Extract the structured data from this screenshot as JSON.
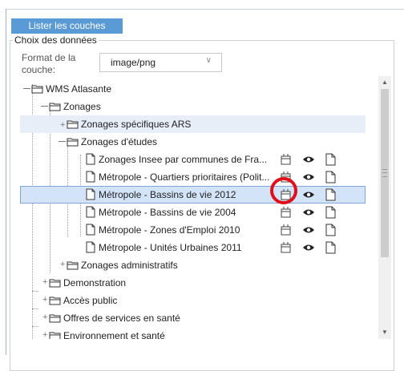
{
  "toolbar": {
    "list_layers_label": "Lister les couches"
  },
  "panel": {
    "legend": "Choix des données",
    "format_label": "Format de la couche:",
    "format_value": "image/png"
  },
  "tree": {
    "root": "WMS Atlasante",
    "zonages": "Zonages",
    "zonages_ars": "Zonages spécifiques ARS",
    "zonages_etudes": "Zonages d'études",
    "layers": [
      "Zonages Insee par communes de Fra...",
      "Métropole - Quartiers prioritaires (Polit...",
      "Métropole - Bassins de vie 2012",
      "Métropole - Bassins de vie 2004",
      "Métropole - Zones d'Emploi 2010",
      "Métropole - Unités Urbaines 2011"
    ],
    "zonages_admin": "Zonages administratifs",
    "others": [
      "Demonstration",
      "Accès public",
      "Offres de services en santé",
      "Environnement et santé"
    ]
  }
}
